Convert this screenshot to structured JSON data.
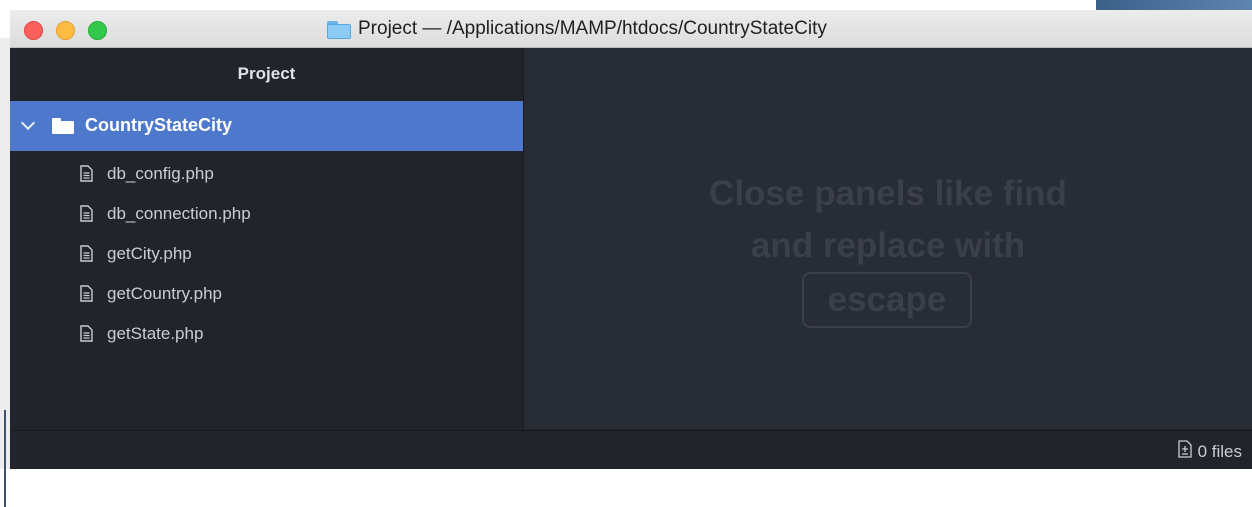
{
  "window": {
    "title": "Project — /Applications/MAMP/htdocs/CountryStateCity",
    "title_icon": "folder-icon"
  },
  "sidebar": {
    "header": "Project",
    "root": {
      "label": "CountryStateCity",
      "expanded": true,
      "icon": "folder-icon"
    },
    "files": [
      {
        "label": "db_config.php",
        "icon": "file-icon"
      },
      {
        "label": "db_connection.php",
        "icon": "file-icon"
      },
      {
        "label": "getCity.php",
        "icon": "file-icon"
      },
      {
        "label": "getCountry.php",
        "icon": "file-icon"
      },
      {
        "label": "getState.php",
        "icon": "file-icon"
      }
    ]
  },
  "editor": {
    "hint_line1": "Close panels like find",
    "hint_line2": "and replace with",
    "hint_key": "escape"
  },
  "status_bar": {
    "files_count": "0 files",
    "icon": "diff-icon"
  },
  "colors": {
    "selection": "#4d78cc",
    "sidebar_bg": "#21252b",
    "editor_bg": "#282c34",
    "close": "#fc605c",
    "minimize": "#fdbc40",
    "maximize": "#34c84a"
  }
}
